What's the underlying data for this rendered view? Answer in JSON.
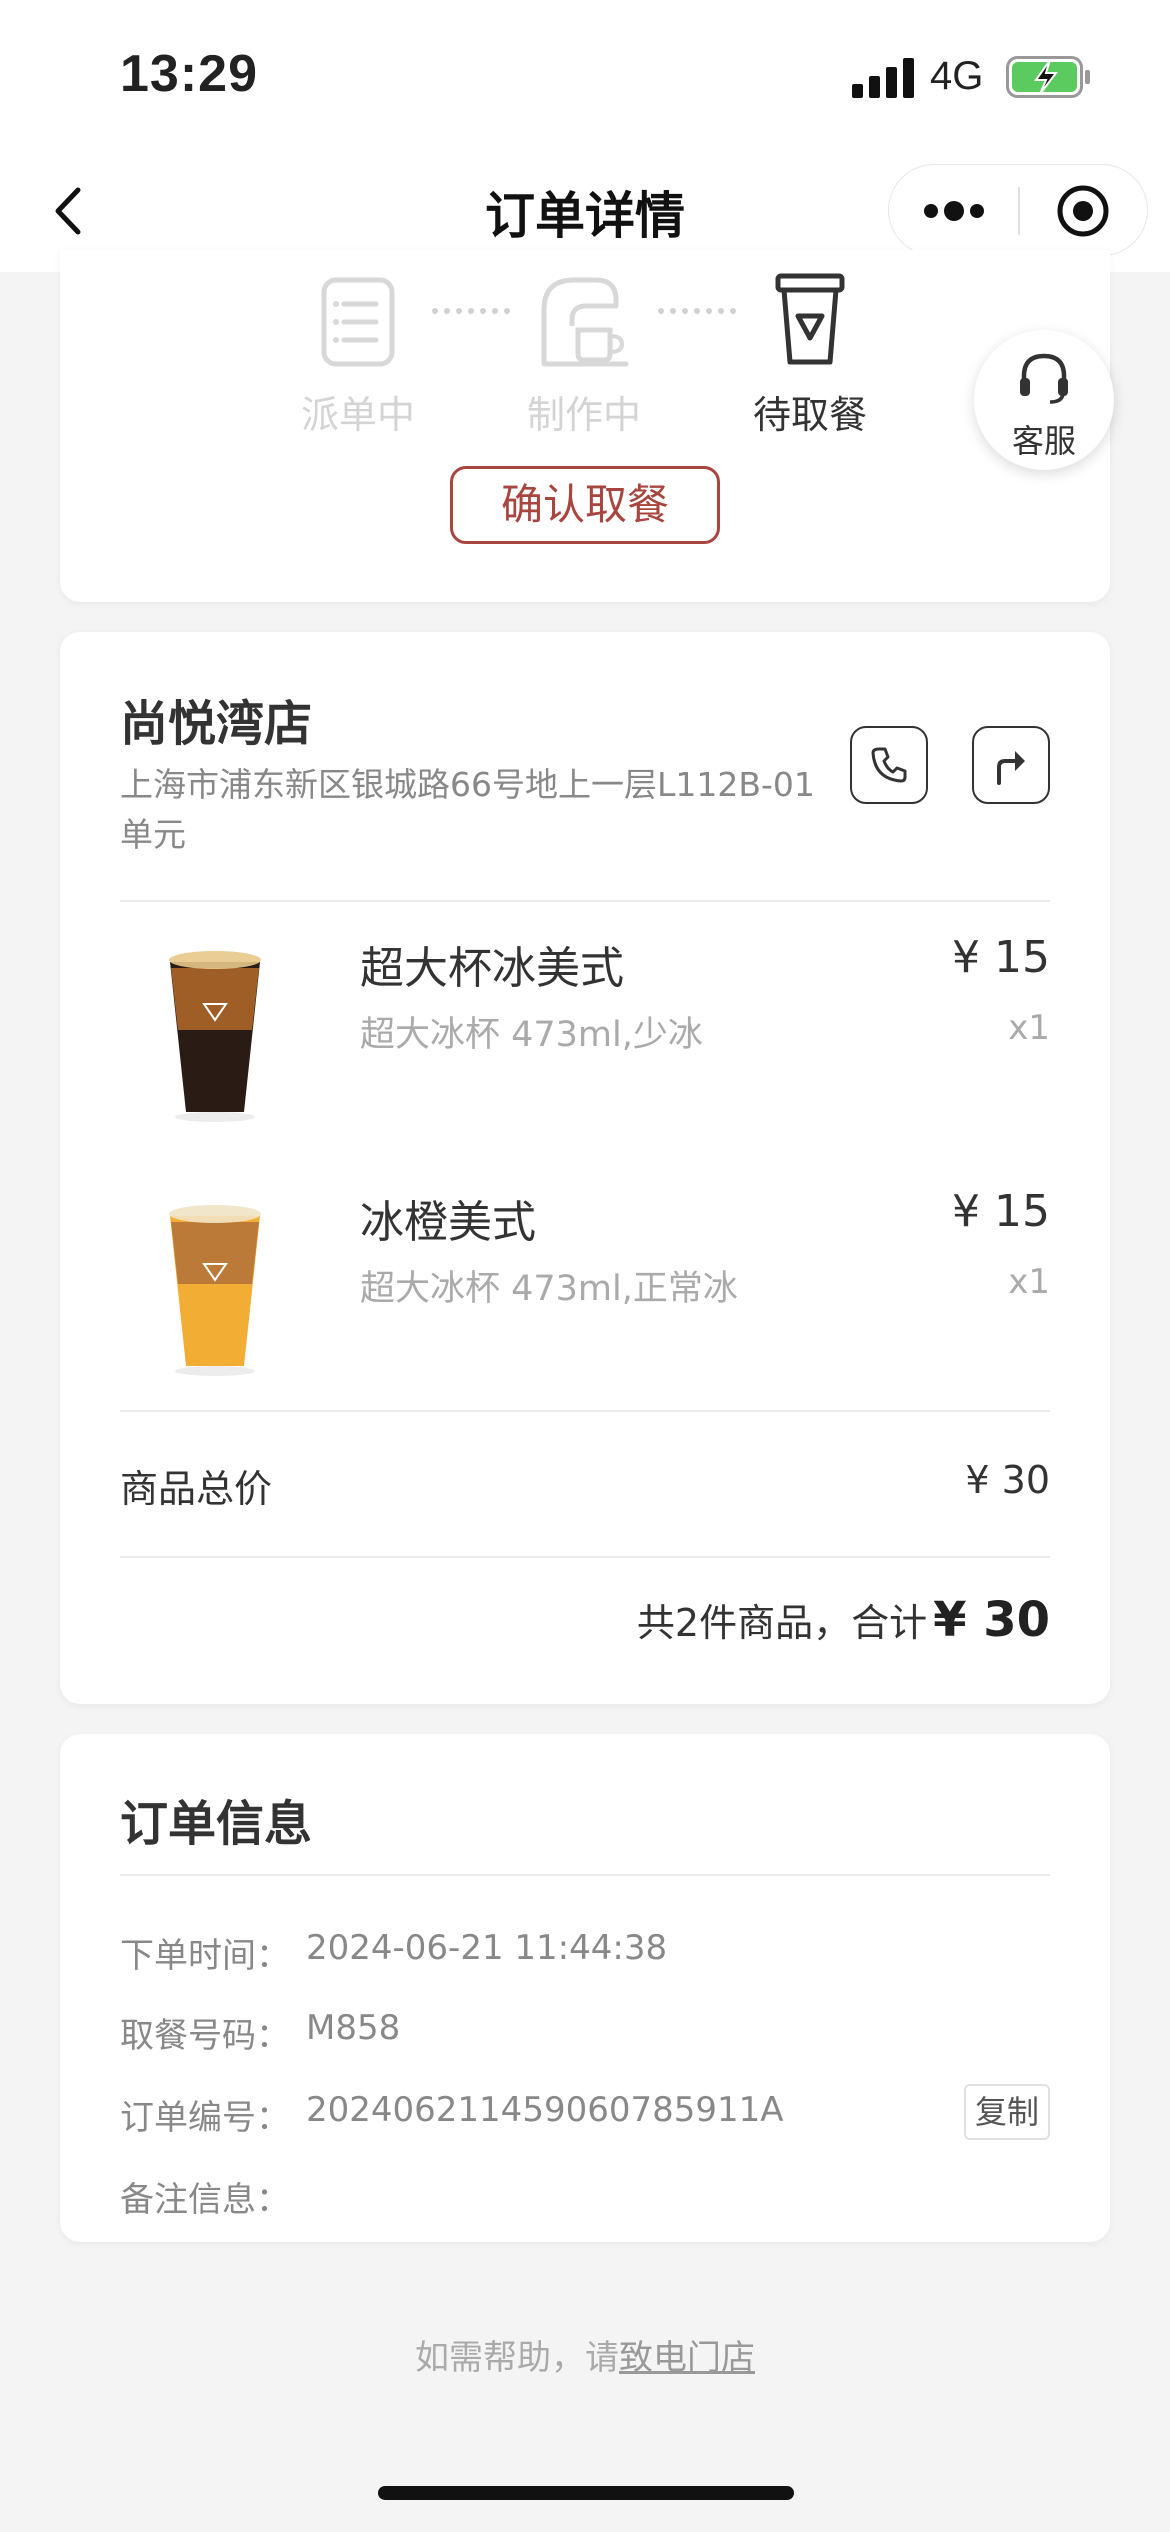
{
  "status_bar": {
    "time": "13:29",
    "network": "4G"
  },
  "nav": {
    "title": "订单详情"
  },
  "progress": {
    "steps": [
      {
        "label": "派单中",
        "icon": "document-list-icon"
      },
      {
        "label": "制作中",
        "icon": "coffee-machine-icon"
      },
      {
        "label": "待取餐",
        "icon": "cup-icon"
      }
    ],
    "active_step": 3,
    "confirm_label": "确认取餐"
  },
  "customer_service": {
    "label": "客服"
  },
  "store": {
    "name": "尚悦湾店",
    "address": "上海市浦东新区银城路66号地上一层L112B-01单元"
  },
  "items": [
    {
      "name": "超大杯冰美式",
      "spec": "超大冰杯 473ml,少冰",
      "price": "¥ 15",
      "qty": "x1",
      "color": "#2a1a14"
    },
    {
      "name": "冰橙美式",
      "spec": "超大冰杯 473ml,正常冰",
      "price": "¥ 15",
      "qty": "x1",
      "color": "#f0a830"
    }
  ],
  "summary": {
    "subtotal_label": "商品总价",
    "subtotal_value": "¥ 30",
    "total_prefix": "共2件商品，合计",
    "total_amount": "¥ 30"
  },
  "order_info": {
    "title": "订单信息",
    "rows": [
      {
        "label": "下单时间：",
        "value": "2024-06-21 11:44:38"
      },
      {
        "label": "取餐号码：",
        "value": "M858"
      },
      {
        "label": "订单编号：",
        "value": "20240621145906078591​1A"
      },
      {
        "label": "备注信息：",
        "value": ""
      }
    ],
    "copy_label": "复制"
  },
  "help": {
    "prefix": "如需帮助，请",
    "link": "致电门店"
  },
  "colors": {
    "accent": "#a8453e",
    "background": "#f4f4f4"
  }
}
